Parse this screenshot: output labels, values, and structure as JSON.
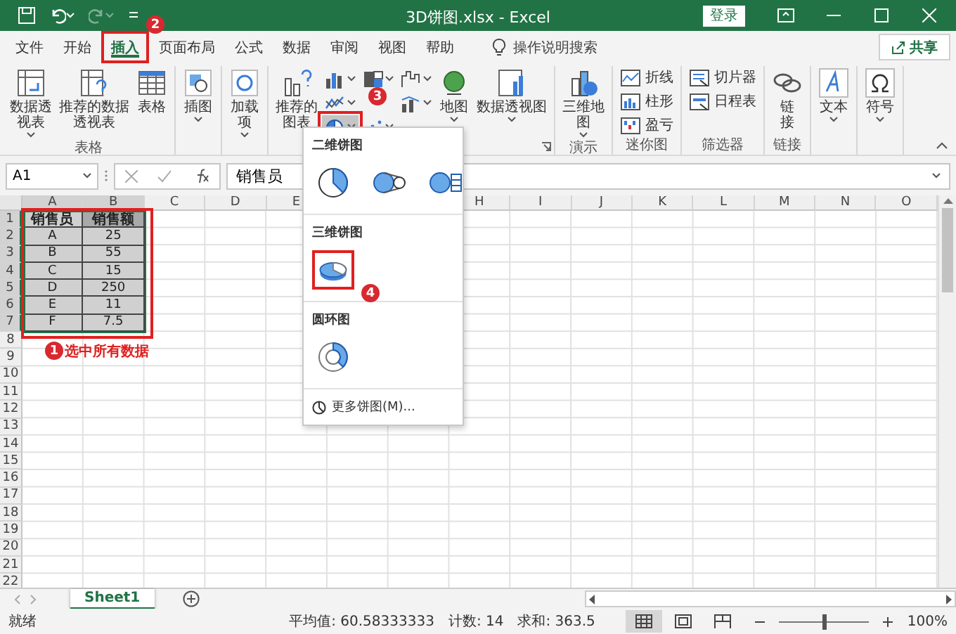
{
  "title_bar": {
    "title": "3D饼图.xlsx  -  Excel",
    "sign_in": "登录"
  },
  "tabs": [
    {
      "label": "文件",
      "selected": false,
      "annotated": false
    },
    {
      "label": "开始",
      "selected": false,
      "annotated": false
    },
    {
      "label": "插入",
      "selected": true,
      "annotated": true
    },
    {
      "label": "页面布局",
      "selected": false,
      "annotated": false
    },
    {
      "label": "公式",
      "selected": false,
      "annotated": false
    },
    {
      "label": "数据",
      "selected": false,
      "annotated": false
    },
    {
      "label": "审阅",
      "selected": false,
      "annotated": false
    },
    {
      "label": "视图",
      "selected": false,
      "annotated": false
    },
    {
      "label": "帮助",
      "selected": false,
      "annotated": false
    }
  ],
  "tell_me": "操作说明搜索",
  "share": "共享",
  "ribbon": [
    {
      "kind": "buttons",
      "label": "表格",
      "items": [
        {
          "kind": "pivot",
          "label": "数据透视表",
          "dropdown": true
        },
        {
          "kind": "recommended-pivot",
          "label": "推荐的数据透视表",
          "dropdown": false
        },
        {
          "kind": "table",
          "label": "表格",
          "dropdown": false
        }
      ]
    },
    {
      "kind": "buttons",
      "items": [
        {
          "kind": "shapes",
          "label": "插图",
          "dropdown": true
        }
      ]
    },
    {
      "kind": "buttons",
      "items": [
        {
          "kind": "addins",
          "label": "加载项",
          "dropdown": true
        }
      ]
    },
    {
      "kind": "charts",
      "items": [
        {
          "kind": "recommended-chart",
          "label": "推荐的图表",
          "dropdown": false
        }
      ],
      "chart_buttons": [
        {
          "kind": "column",
          "pressed": false,
          "annotated": false
        },
        {
          "kind": "hierarchy",
          "pressed": false,
          "annotated": false
        },
        {
          "kind": "waterfall",
          "pressed": false,
          "annotated": false
        },
        {
          "kind": "line",
          "pressed": false,
          "annotated": false
        },
        {
          "kind": "combo",
          "pressed": false,
          "annotated": false
        },
        {
          "kind": "pie",
          "pressed": true,
          "annotated": true
        },
        {
          "kind": "scatter",
          "pressed": false,
          "annotated": false
        }
      ],
      "extra": [
        {
          "kind": "map",
          "label": "地图",
          "dropdown": true
        },
        {
          "kind": "pivot-chart",
          "label": "数据透视图",
          "dropdown": true
        }
      ]
    },
    {
      "kind": "buttons",
      "label": "演示",
      "items": [
        {
          "kind": "map3d",
          "label": "三维地图",
          "dropdown": true
        }
      ]
    },
    {
      "kind": "list",
      "label": "迷你图",
      "items": [
        {
          "kind": "spark-line",
          "label": "折线"
        },
        {
          "kind": "spark-column",
          "label": "柱形"
        },
        {
          "kind": "spark-winloss",
          "label": "盈亏"
        }
      ]
    },
    {
      "kind": "list",
      "label": "筛选器",
      "items": [
        {
          "kind": "slicer",
          "label": "切片器"
        },
        {
          "kind": "timeline",
          "label": "日程表"
        }
      ]
    },
    {
      "kind": "buttons",
      "label": "链接",
      "items": [
        {
          "kind": "link",
          "label": "链接",
          "dropdown": false
        }
      ]
    },
    {
      "kind": "buttons",
      "items": [
        {
          "kind": "text",
          "label": "文本",
          "dropdown": true
        }
      ]
    },
    {
      "kind": "buttons",
      "items": [
        {
          "kind": "symbol",
          "label": "符号",
          "dropdown": true
        }
      ]
    }
  ],
  "formula_bar": {
    "name_box": "A1",
    "value": "销售员"
  },
  "pie_menu": {
    "sections": [
      {
        "title": "二维饼图",
        "charts": [
          {
            "kind": "pie",
            "annotated": false
          },
          {
            "kind": "pie-of-pie",
            "annotated": false
          },
          {
            "kind": "bar-of-pie",
            "annotated": false
          }
        ]
      },
      {
        "title": "三维饼图",
        "charts": [
          {
            "kind": "pie-3d",
            "annotated": true
          }
        ]
      },
      {
        "title": "圆环图",
        "charts": [
          {
            "kind": "donut",
            "annotated": false
          }
        ]
      }
    ],
    "more": "更多饼图(M)..."
  },
  "sheet": {
    "columns": [
      {
        "label": "A",
        "selected": true
      },
      {
        "label": "B",
        "selected": true
      },
      {
        "label": "C",
        "selected": false
      },
      {
        "label": "D",
        "selected": false
      },
      {
        "label": "E",
        "selected": false
      },
      {
        "label": "H",
        "selected": false
      },
      {
        "label": "I",
        "selected": false
      },
      {
        "label": "J",
        "selected": false
      },
      {
        "label": "K",
        "selected": false
      },
      {
        "label": "L",
        "selected": false
      },
      {
        "label": "M",
        "selected": false
      },
      {
        "label": "N",
        "selected": false
      },
      {
        "label": "O",
        "selected": false
      }
    ],
    "rows": [
      {
        "number": "1",
        "selected": true,
        "kind": "header",
        "cells": [
          "销售员",
          "销售额"
        ]
      },
      {
        "number": "2",
        "selected": true,
        "kind": "data",
        "cells": [
          "A",
          "25"
        ]
      },
      {
        "number": "3",
        "selected": true,
        "kind": "data",
        "cells": [
          "B",
          "55"
        ]
      },
      {
        "number": "4",
        "selected": true,
        "kind": "data",
        "cells": [
          "C",
          "15"
        ]
      },
      {
        "number": "5",
        "selected": true,
        "kind": "data",
        "cells": [
          "D",
          "250"
        ]
      },
      {
        "number": "6",
        "selected": true,
        "kind": "data",
        "cells": [
          "E",
          "11"
        ]
      },
      {
        "number": "7",
        "selected": true,
        "kind": "data",
        "cells": [
          "F",
          "7.5"
        ]
      },
      {
        "number": "8",
        "selected": false
      },
      {
        "number": "9",
        "selected": false
      },
      {
        "number": "10",
        "selected": false
      },
      {
        "number": "11",
        "selected": false
      },
      {
        "number": "12",
        "selected": false
      },
      {
        "number": "13",
        "selected": false
      },
      {
        "number": "14",
        "selected": false
      },
      {
        "number": "15",
        "selected": false
      },
      {
        "number": "16",
        "selected": false
      },
      {
        "number": "17",
        "selected": false
      },
      {
        "number": "18",
        "selected": false
      },
      {
        "number": "19",
        "selected": false
      },
      {
        "number": "20",
        "selected": false
      },
      {
        "number": "21",
        "selected": false
      },
      {
        "number": "22",
        "selected": false
      }
    ]
  },
  "sheet_tabs": [
    {
      "label": "Sheet1",
      "selected": true
    }
  ],
  "status_bar": {
    "status": "就绪",
    "average": "平均值: 60.58333333",
    "count": "计数: 14",
    "sum": "求和: 363.5",
    "views": [
      {
        "kind": "normal",
        "selected": true
      },
      {
        "kind": "page-layout",
        "selected": false
      },
      {
        "kind": "page-break",
        "selected": false
      }
    ],
    "zoom": {
      "level": 0.5,
      "reading": "100%"
    }
  },
  "annotations": {
    "badges": [
      {
        "number": "1",
        "note": "选中所有数据"
      },
      {
        "number": "2"
      },
      {
        "number": "3"
      },
      {
        "number": "4"
      }
    ]
  }
}
